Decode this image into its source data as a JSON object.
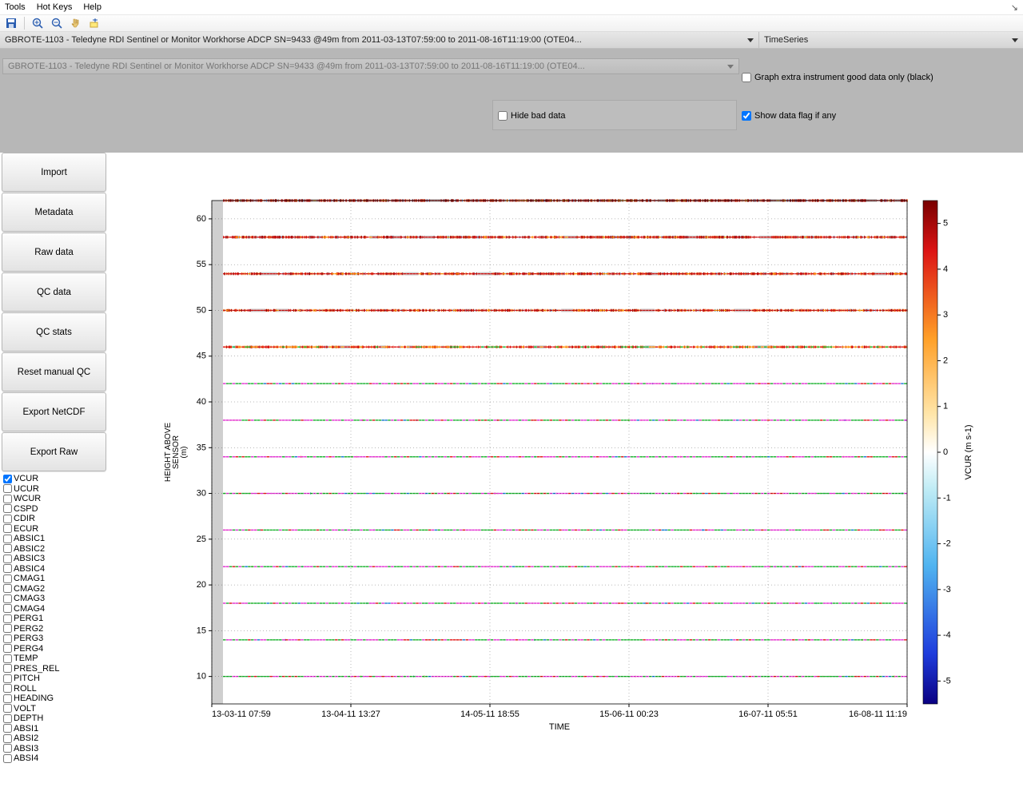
{
  "menu": {
    "tools": "Tools",
    "hotkeys": "Hot Keys",
    "help": "Help",
    "dock": "↘"
  },
  "toolbar_icons": [
    "save-icon",
    "zoom-in-icon",
    "zoom-out-icon",
    "pan-icon",
    "data-cursor-icon"
  ],
  "selectors": {
    "dataset": "GBROTE-1103 - Teledyne RDI Sentinel or Monitor Workhorse ADCP SN=9433 @49m from 2011-03-13T07:59:00 to 2011-08-16T11:19:00 (OTE04...",
    "view": "TimeSeries"
  },
  "options": {
    "ghost_label": "GBROTE-1103 - Teledyne RDI Sentinel or Monitor Workhorse ADCP SN=9433 @49m from 2011-03-13T07:59:00 to 2011-08-16T11:19:00 (OTE04...",
    "graph_extra": {
      "label": "Graph extra instrument good data only (black)",
      "checked": false
    },
    "hide_bad": {
      "label": "Hide bad data",
      "checked": false
    },
    "show_flag": {
      "label": "Show data flag if any",
      "checked": true
    }
  },
  "buttons": [
    "Import",
    "Metadata",
    "Raw data",
    "QC data",
    "QC stats",
    "Reset manual QC",
    "Export NetCDF",
    "Export Raw"
  ],
  "variables": [
    {
      "name": "VCUR",
      "checked": true
    },
    {
      "name": "UCUR",
      "checked": false
    },
    {
      "name": "WCUR",
      "checked": false
    },
    {
      "name": "CSPD",
      "checked": false
    },
    {
      "name": "CDIR",
      "checked": false
    },
    {
      "name": "ECUR",
      "checked": false
    },
    {
      "name": "ABSIC1",
      "checked": false
    },
    {
      "name": "ABSIC2",
      "checked": false
    },
    {
      "name": "ABSIC3",
      "checked": false
    },
    {
      "name": "ABSIC4",
      "checked": false
    },
    {
      "name": "CMAG1",
      "checked": false
    },
    {
      "name": "CMAG2",
      "checked": false
    },
    {
      "name": "CMAG3",
      "checked": false
    },
    {
      "name": "CMAG4",
      "checked": false
    },
    {
      "name": "PERG1",
      "checked": false
    },
    {
      "name": "PERG2",
      "checked": false
    },
    {
      "name": "PERG3",
      "checked": false
    },
    {
      "name": "PERG4",
      "checked": false
    },
    {
      "name": "TEMP",
      "checked": false
    },
    {
      "name": "PRES_REL",
      "checked": false
    },
    {
      "name": "PITCH",
      "checked": false
    },
    {
      "name": "ROLL",
      "checked": false
    },
    {
      "name": "HEADING",
      "checked": false
    },
    {
      "name": "VOLT",
      "checked": false
    },
    {
      "name": "DEPTH",
      "checked": false
    },
    {
      "name": "ABSI1",
      "checked": false
    },
    {
      "name": "ABSI2",
      "checked": false
    },
    {
      "name": "ABSI3",
      "checked": false
    },
    {
      "name": "ABSI4",
      "checked": false
    }
  ],
  "chart_data": {
    "type": "heatmap",
    "xlabel": "TIME",
    "ylabel": "HEIGHT ABOVE SENSOR (m)",
    "colorbar_label": "VCUR (m s-1)",
    "x_ticks": [
      "13-03-11 07:59",
      "13-04-11 13:27",
      "14-05-11 18:55",
      "15-06-11 00:23",
      "16-07-11 05:51",
      "16-08-11 11:19"
    ],
    "y_ticks": [
      10,
      15,
      20,
      25,
      30,
      35,
      40,
      45,
      50,
      55,
      60
    ],
    "ylim": [
      7,
      62
    ],
    "color_ticks": [
      -5,
      -4,
      -3,
      -2,
      -1,
      0,
      1,
      2,
      3,
      4,
      5
    ],
    "color_range": [
      -5.5,
      5.5
    ],
    "bin_heights": [
      10,
      14,
      18,
      22,
      26,
      30,
      34,
      38,
      42,
      46,
      50,
      54,
      58,
      62
    ],
    "note": "Upper bins (~46–62 m) show dense orange/positive flags; lower bins show sparse green/magenta QC flags over a mostly white (near-zero) background."
  }
}
